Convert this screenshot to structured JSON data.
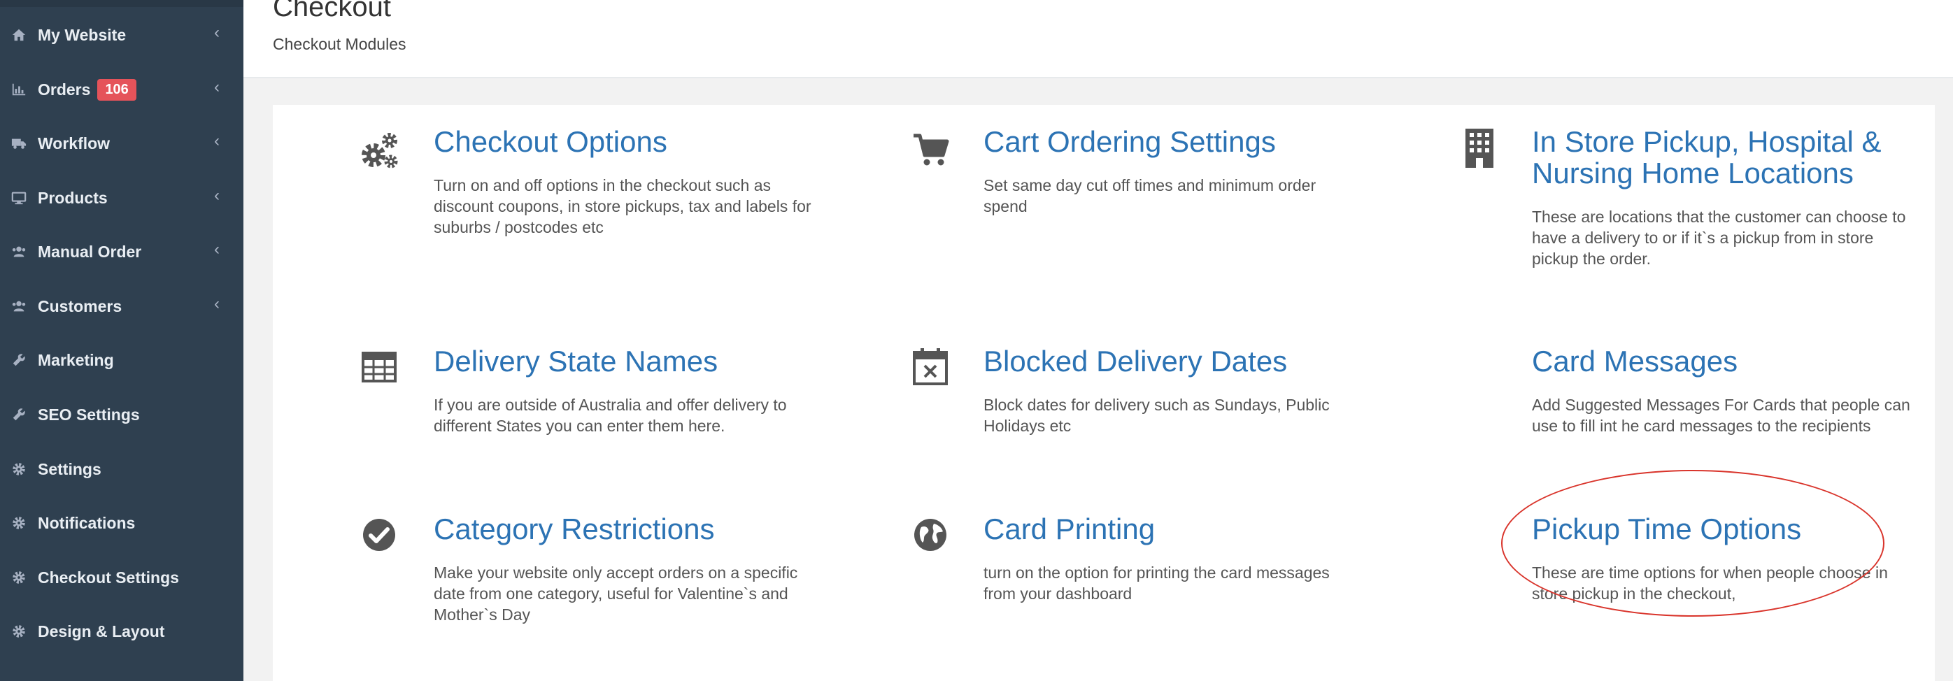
{
  "sidebar": {
    "items": [
      {
        "label": "My Website",
        "icon": "home-icon",
        "has_chevron": true
      },
      {
        "label": "Orders",
        "icon": "bar-chart-icon",
        "badge": "106",
        "has_chevron": true
      },
      {
        "label": "Workflow",
        "icon": "truck-icon",
        "has_chevron": true
      },
      {
        "label": "Products",
        "icon": "desktop-icon",
        "has_chevron": true
      },
      {
        "label": "Manual Order",
        "icon": "users-icon",
        "has_chevron": true
      },
      {
        "label": "Customers",
        "icon": "users-icon",
        "has_chevron": true
      },
      {
        "label": "Marketing",
        "icon": "wrench-icon",
        "has_chevron": false
      },
      {
        "label": "SEO Settings",
        "icon": "wrench-icon",
        "has_chevron": false
      },
      {
        "label": "Settings",
        "icon": "gear-icon",
        "has_chevron": false
      },
      {
        "label": "Notifications",
        "icon": "gear-icon",
        "has_chevron": false
      },
      {
        "label": "Checkout Settings",
        "icon": "gear-icon",
        "has_chevron": false
      },
      {
        "label": "Design & Layout",
        "icon": "gear-icon",
        "has_chevron": false
      }
    ],
    "chevron": "‹"
  },
  "header": {
    "title": "Checkout",
    "subtitle": "Checkout Modules"
  },
  "modules": [
    {
      "title": "Checkout Options",
      "icon": "gears-icon",
      "description": "Turn on and off options in the checkout such as discount coupons, in store pickups, tax and labels for suburbs / postcodes etc"
    },
    {
      "title": "Cart Ordering Settings",
      "icon": "shopping-cart-icon",
      "description": "Set same day cut off times and minimum order spend"
    },
    {
      "title": "In Store Pickup, Hospital & Nursing Home Locations",
      "icon": "building-icon",
      "description": "These are locations that the customer can choose to have a delivery to or if it`s a pickup from in store pickup the order."
    },
    {
      "title": "Delivery State Names",
      "icon": "table-icon",
      "description": "If you are outside of Australia and offer delivery to different States you can enter them here."
    },
    {
      "title": "Blocked Delivery Dates",
      "icon": "calendar-times-icon",
      "description": "Block dates for delivery such as Sundays, Public Holidays etc"
    },
    {
      "title": "Card Messages",
      "icon": "",
      "description": "Add Suggested Messages For Cards that people can use to fill int he card messages to the recipients"
    },
    {
      "title": "Category Restrictions",
      "icon": "check-circle-icon",
      "description": "Make your website only accept orders on a specific date from one category, useful for Valentine`s and Mother`s Day"
    },
    {
      "title": "Card Printing",
      "icon": "globe-icon",
      "description": "turn on the option for printing the card messages from your dashboard"
    },
    {
      "title": "Pickup Time Options",
      "icon": "",
      "description": "These are time options for when people choose in store pickup in the checkout,"
    }
  ],
  "colors": {
    "sidebar_bg": "#2f4050",
    "link_blue": "#2c73b4",
    "badge_red": "#e5535a",
    "annotation_red": "#d9342b"
  }
}
